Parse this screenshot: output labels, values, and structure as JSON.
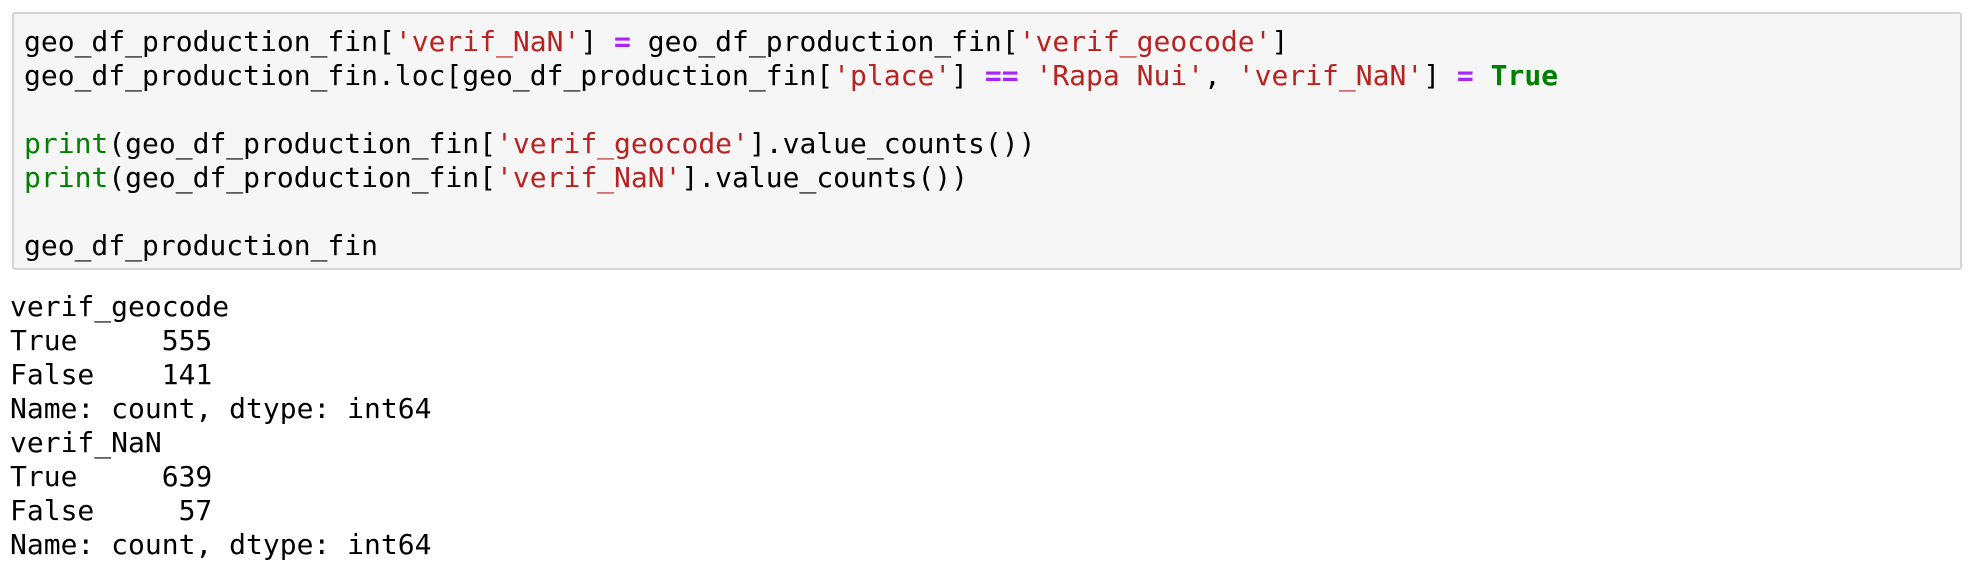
{
  "code_cell": {
    "lines": [
      [
        {
          "t": "geo_df_production_fin[",
          "c": "plain"
        },
        {
          "t": "'verif_NaN'",
          "c": "str"
        },
        {
          "t": "] ",
          "c": "plain"
        },
        {
          "t": "=",
          "c": "op"
        },
        {
          "t": " geo_df_production_fin[",
          "c": "plain"
        },
        {
          "t": "'verif_geocode'",
          "c": "str"
        },
        {
          "t": "]",
          "c": "plain"
        }
      ],
      [
        {
          "t": "geo_df_production_fin.loc[geo_df_production_fin[",
          "c": "plain"
        },
        {
          "t": "'place'",
          "c": "str"
        },
        {
          "t": "] ",
          "c": "plain"
        },
        {
          "t": "==",
          "c": "op"
        },
        {
          "t": " ",
          "c": "plain"
        },
        {
          "t": "'Rapa Nui'",
          "c": "str"
        },
        {
          "t": ", ",
          "c": "plain"
        },
        {
          "t": "'verif_NaN'",
          "c": "str"
        },
        {
          "t": "] ",
          "c": "plain"
        },
        {
          "t": "=",
          "c": "op"
        },
        {
          "t": " ",
          "c": "plain"
        },
        {
          "t": "True",
          "c": "kw"
        }
      ],
      [],
      [
        {
          "t": "print",
          "c": "fn"
        },
        {
          "t": "(geo_df_production_fin[",
          "c": "plain"
        },
        {
          "t": "'verif_geocode'",
          "c": "str"
        },
        {
          "t": "].value_counts())",
          "c": "plain"
        }
      ],
      [
        {
          "t": "print",
          "c": "fn"
        },
        {
          "t": "(geo_df_production_fin[",
          "c": "plain"
        },
        {
          "t": "'verif_NaN'",
          "c": "str"
        },
        {
          "t": "].value_counts())",
          "c": "plain"
        }
      ],
      [],
      [
        {
          "t": "geo_df_production_fin",
          "c": "plain"
        }
      ]
    ]
  },
  "output": {
    "lines": [
      "verif_geocode",
      "True     555",
      "False    141",
      "Name: count, dtype: int64",
      "verif_NaN",
      "True     639",
      "False     57",
      "Name: count, dtype: int64"
    ]
  },
  "colors": {
    "cell_background": "#f6f6f6",
    "cell_border": "#d4d4d4",
    "string": "#ba2121",
    "operator": "#aa22ff",
    "keyword": "#008000",
    "builtin": "#008000"
  }
}
